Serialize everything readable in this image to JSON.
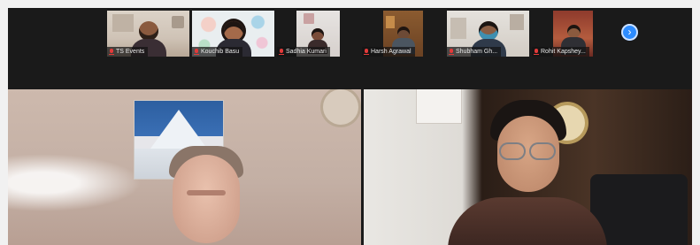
{
  "participants": [
    {
      "name": "TS Events",
      "muted": true
    },
    {
      "name": "Kouchib Basu",
      "muted": true
    },
    {
      "name": "Sadhia Kumari",
      "muted": true
    },
    {
      "name": "Harsh Agrawal",
      "muted": true
    },
    {
      "name": "Shubham Gh...",
      "muted": true
    },
    {
      "name": "Rohit Kapshey...",
      "muted": true
    }
  ],
  "controls": {
    "next_page_icon": "chevron-right-icon",
    "next_page_glyph": "›"
  },
  "colors": {
    "active_speaker_border": "#9ed34a",
    "accent": "#2d8cff",
    "muted_icon": "#e23a3a"
  }
}
